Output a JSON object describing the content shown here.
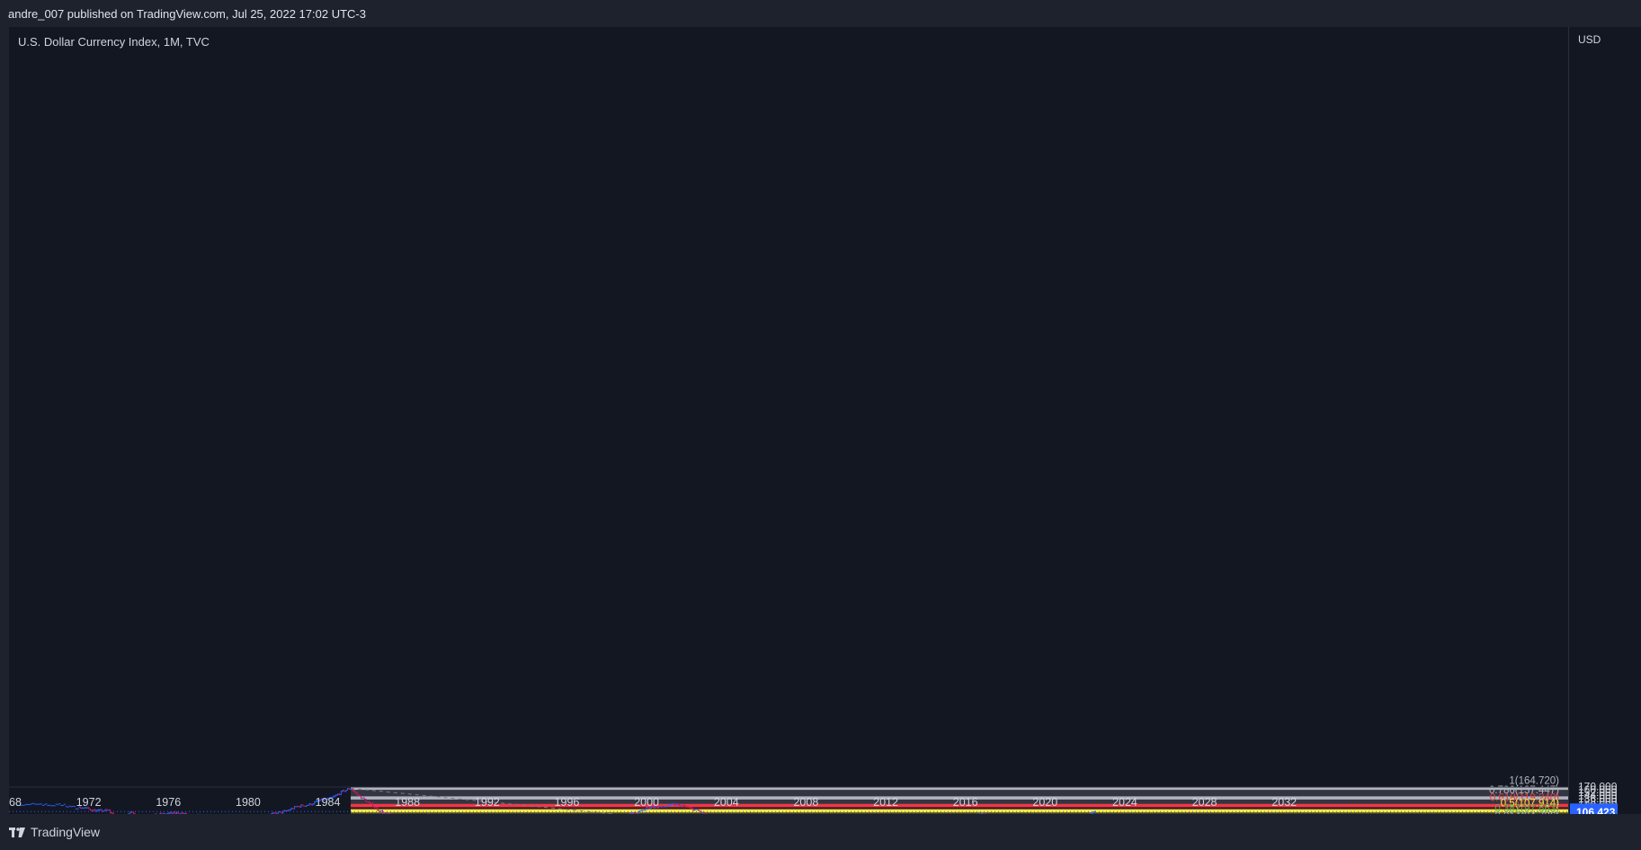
{
  "header": {
    "published": "andre_007 published on TradingView.com, Jul 25, 2022 17:02 UTC-3"
  },
  "chart": {
    "symbol_label": "U.S. Dollar Currency Index, 1M, TVC"
  },
  "price_axis": {
    "currency": "USD",
    "ticks": [
      "170.000",
      "160.000",
      "152.000",
      "144.000",
      "136.000",
      "128.000",
      "120.500",
      "115.500",
      "109.500",
      "103.500",
      "97.500",
      "93.500",
      "89.500",
      "85.500",
      "81.500",
      "77.500",
      "74.000",
      "71.000",
      "68.000",
      "65.200"
    ],
    "last_price": "106.423"
  },
  "time_axis": {
    "ticks": [
      "68",
      "1972",
      "1976",
      "1980",
      "1984",
      "1988",
      "1992",
      "1996",
      "2000",
      "2004",
      "2008",
      "2012",
      "2016",
      "2020",
      "2024",
      "2028",
      "2032"
    ]
  },
  "fib_levels": [
    {
      "label": "1(164.720)",
      "ratio": 1,
      "price": 164.72,
      "color": "#b2b5be"
    },
    {
      "label": "0.786(137.447)",
      "ratio": 0.786,
      "price": 137.447,
      "color": "#b2b5be"
    },
    {
      "label": "0.618(119.240)",
      "ratio": 0.618,
      "price": 119.24,
      "color": "#f23645"
    },
    {
      "label": "0.5(107.914)",
      "ratio": 0.5,
      "price": 107.914,
      "color": "#ffeb3b"
    },
    {
      "label": "0.382(97.663)",
      "ratio": 0.382,
      "price": 97.663,
      "color": "#4caf50"
    },
    {
      "label": "0.214(84.726)",
      "ratio": 0.214,
      "price": 84.726,
      "color": "#b2b5be"
    },
    {
      "label": "0(70.698)",
      "ratio": 0,
      "price": 70.698,
      "color": "#b2b5be"
    }
  ],
  "fib_zone_colors": [
    "#b2b5be",
    "#b2b5be",
    "#f23645",
    "#ffeb3b",
    "#4caf50",
    "#b2b5be"
  ],
  "colors": {
    "up": "#2962ff",
    "down": "#c2185b",
    "last_price_bg": "#2962ff",
    "background": "#131722"
  },
  "chart_data": {
    "type": "line",
    "title": "U.S. Dollar Currency Index, 1M, TVC",
    "xlabel": "",
    "ylabel": "USD",
    "y_scale": "log",
    "ylim": [
      65.2,
      175
    ],
    "x": [
      1968.5,
      1970,
      1971,
      1972,
      1973,
      1973.5,
      1974,
      1975,
      1976,
      1977,
      1978,
      1978.9,
      1980,
      1980.6,
      1982,
      1983,
      1984,
      1985.15,
      1986,
      1987,
      1987.9,
      1989,
      1990,
      1991,
      1992,
      1992.7,
      1993.5,
      1994.5,
      1995.3,
      1996,
      1997,
      1998,
      1999,
      2000,
      2001,
      2001.5,
      2002,
      2003,
      2004,
      2005,
      2006,
      2007,
      2008,
      2008.25,
      2009,
      2009.5,
      2010,
      2010.5,
      2011,
      2011.5,
      2012,
      2013,
      2014,
      2014.5,
      2015,
      2016,
      2017,
      2018,
      2019,
      2020,
      2021,
      2021.5,
      2022,
      2022.5
    ],
    "y": [
      121.5,
      121.4,
      118,
      111,
      107,
      92,
      103,
      96,
      104,
      101,
      96,
      88,
      86,
      93,
      110,
      122,
      135,
      164.7,
      125,
      100,
      90,
      101,
      94,
      88,
      96,
      80,
      95,
      88,
      82,
      87,
      97,
      99,
      98,
      113,
      119,
      120,
      117,
      100,
      88,
      85,
      88,
      82,
      74,
      71,
      86,
      76,
      82,
      73,
      76,
      74,
      83,
      81,
      80,
      87,
      98,
      98,
      100,
      90,
      97,
      99,
      92,
      90,
      96,
      108
    ]
  }
}
